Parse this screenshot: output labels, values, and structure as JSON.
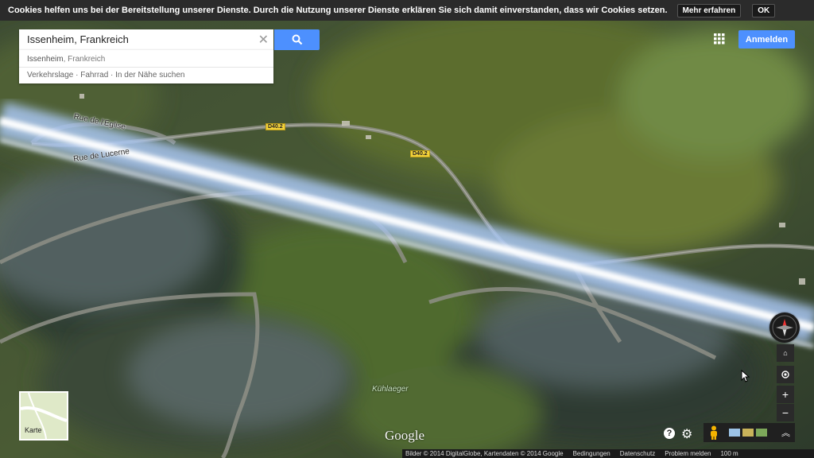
{
  "cookie_bar": {
    "message": "Cookies helfen uns bei der Bereitstellung unserer Dienste. Durch die Nutzung unserer Dienste erklären Sie sich damit einverstanden, dass wir Cookies setzen.",
    "learn_more": "Mehr erfahren",
    "ok": "OK"
  },
  "search": {
    "value": "Issenheim, Frankreich",
    "suggestion_main": "Issenheim",
    "suggestion_rest": ", Frankreich",
    "suggestion_links": "Verkehrslage · Fahrrad · In der Nähe suchen"
  },
  "header": {
    "sign_in": "Anmelden",
    "accent": "#4d90fe"
  },
  "map": {
    "road_labels": {
      "eglise": "Rue de l'Eglise",
      "lucerne": "Rue de Lucerne"
    },
    "shields": {
      "a": "D40.2",
      "b": "D40.2"
    },
    "place": "Kühlaeger"
  },
  "minimap": {
    "label": "Karte"
  },
  "logo": "Google",
  "footer": {
    "imagery": "Bilder © 2014 DigitalGlobe, Kartendaten © 2014 Google",
    "terms": "Bedingungen",
    "privacy": "Datenschutz",
    "report": "Problem melden",
    "scale": "100 m"
  },
  "icons": [
    "search-icon",
    "clear-icon",
    "apps-grid-icon",
    "compass-icon",
    "tilt-icon",
    "my-location-icon",
    "zoom-in-icon",
    "zoom-out-icon",
    "help-icon",
    "settings-icon",
    "pegman-icon",
    "expand-icon"
  ]
}
